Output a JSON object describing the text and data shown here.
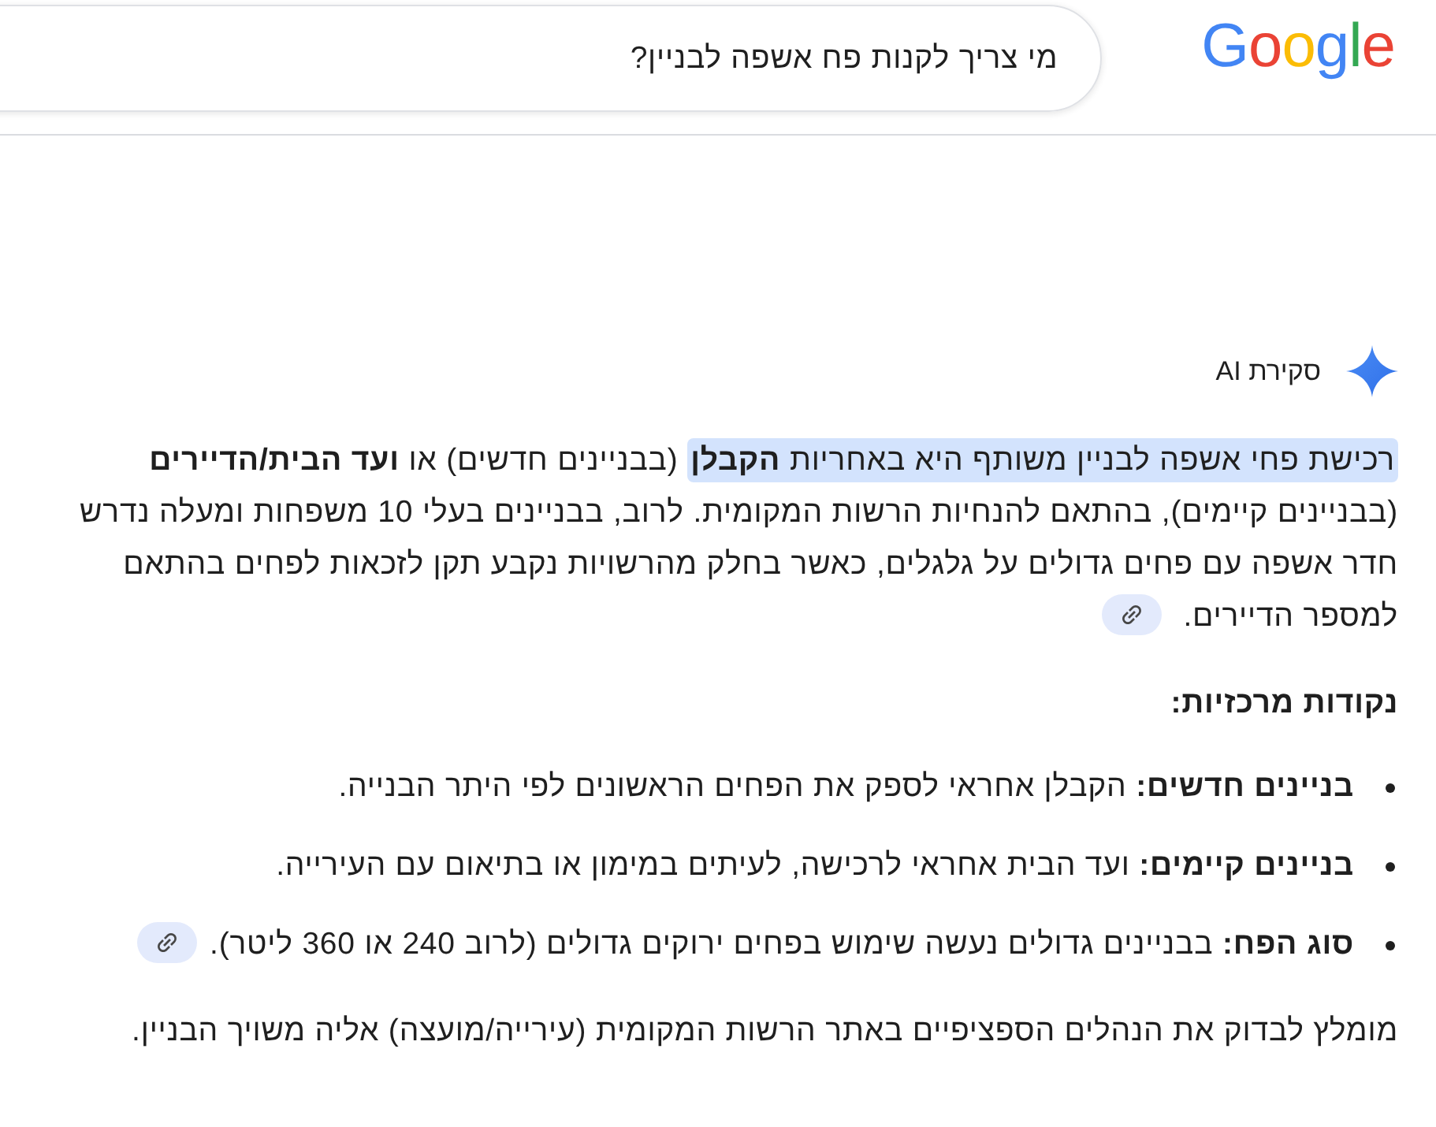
{
  "header": {
    "logo": {
      "text": "Google"
    },
    "search": {
      "value": "מי צריך לקנות פח אשפה לבניין?"
    }
  },
  "ai_overview": {
    "label": "סקירת AI",
    "summary": {
      "segments": [
        {
          "text": "רכישת פחי אשפה לבניין משותף היא באחריות **הקבלן**",
          "highlighted": true
        },
        {
          "text": "(בבניינים חדשים) או **ועד הבית/הדיירים** (בבניינים קיימים), בהתאם להנחיות הרשות המקומית. לרוב, בבניינים בעלי 10 משפחות ומעלה נדרש חדר אשפה עם פחים גדולים על גלגלים, כאשר בחלק מהרשויות נקבע תקן לזכאות לפחים בהתאם למספר הדיירים.",
          "highlighted": false
        }
      ],
      "source_link": true
    },
    "key_points_heading": "נקודות מרכזיות:",
    "key_points": [
      {
        "text": "**בניינים חדשים:** הקבלן אחראי לספק את הפחים הראשונים לפי היתר הבנייה.",
        "source_link": false
      },
      {
        "text": "**בניינים קיימים:** ועד הבית אחראי לרכישה, לעיתים במימון או בתיאום עם העירייה.",
        "source_link": false
      },
      {
        "text": "**סוג הפח:** בבניינים גדולים נעשה שימוש בפחים ירוקים גדולים (לרוב 240 או 360 ליטר).",
        "source_link": true
      }
    ],
    "closing": "מומלץ לבדוק את הנהלים הספציפיים באתר הרשות המקומית (עירייה/מועצה) אליה משויך הבניין."
  }
}
